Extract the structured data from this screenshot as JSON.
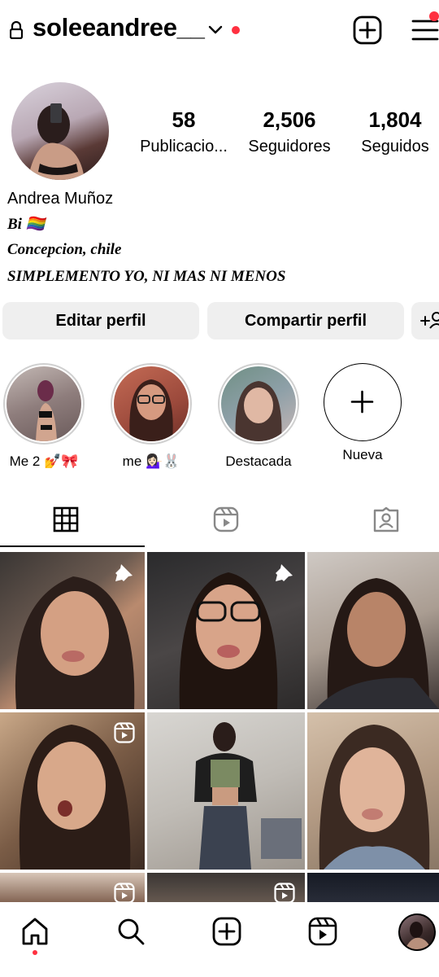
{
  "header": {
    "username": "soleeandree__",
    "icons": [
      "lock-icon",
      "chevron-down-icon",
      "new-post-icon",
      "menu-icon"
    ]
  },
  "profile": {
    "stats": [
      {
        "value": "58",
        "label": "Publicacio..."
      },
      {
        "value": "2,506",
        "label": "Seguidores"
      },
      {
        "value": "1,804",
        "label": "Seguidos"
      }
    ],
    "name": "Andrea Muñoz",
    "bio": [
      "Bi 🏳️‍🌈",
      "Concepcion, chile",
      "SIMPLEMENTO YO, NI MAS NI MENOS"
    ]
  },
  "actions": {
    "edit": "Editar perfil",
    "share": "Compartir perfil"
  },
  "highlights": [
    {
      "label": "Me 2 💅🎀"
    },
    {
      "label": "me 💁🏻‍♀️🐰"
    },
    {
      "label": "Destacada"
    },
    {
      "label": "Nueva"
    }
  ],
  "tabs": [
    "grid-icon",
    "reels-icon",
    "tagged-icon"
  ],
  "grid": [
    {
      "badge": "pin-icon"
    },
    {
      "badge": "pin-icon"
    },
    {
      "badge": "reel-icon"
    },
    {
      "badge": "reel-icon"
    },
    {
      "badge": ""
    },
    {
      "badge": ""
    },
    {
      "badge": "reel-icon"
    },
    {
      "badge": "reel-icon"
    },
    {
      "badge": ""
    }
  ],
  "bottom_nav": [
    "home-icon",
    "search-icon",
    "create-icon",
    "reels-icon",
    "profile-avatar"
  ],
  "colors": {
    "notification": "#ff3040",
    "button_bg": "#efefef"
  }
}
